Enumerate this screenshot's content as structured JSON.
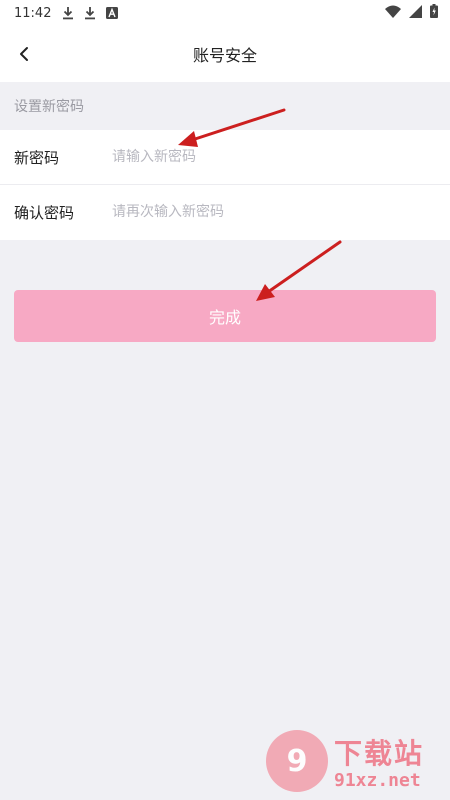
{
  "status_bar": {
    "time": "11:42",
    "left_icons": [
      "download-icon",
      "download-icon",
      "a-letter-icon"
    ],
    "right_icons": [
      "wifi-icon",
      "signal-icon",
      "battery-icon"
    ]
  },
  "nav": {
    "title": "账号安全",
    "back_icon": "chevron-left-icon"
  },
  "section": {
    "title": "设置新密码"
  },
  "form": {
    "new_password": {
      "label": "新密码",
      "placeholder": "请输入新密码",
      "value": ""
    },
    "confirm_password": {
      "label": "确认密码",
      "placeholder": "请再次输入新密码",
      "value": ""
    }
  },
  "actions": {
    "done_label": "完成",
    "done_color": "#f7a9c4"
  },
  "watermark": {
    "logo_text": "9",
    "brand_cn": "下载站",
    "brand_en": "91xz.net"
  },
  "colors": {
    "accent": "#f7a9c4",
    "annotation_arrow": "#cc1f1f",
    "page_bg": "#f0f0f4"
  }
}
